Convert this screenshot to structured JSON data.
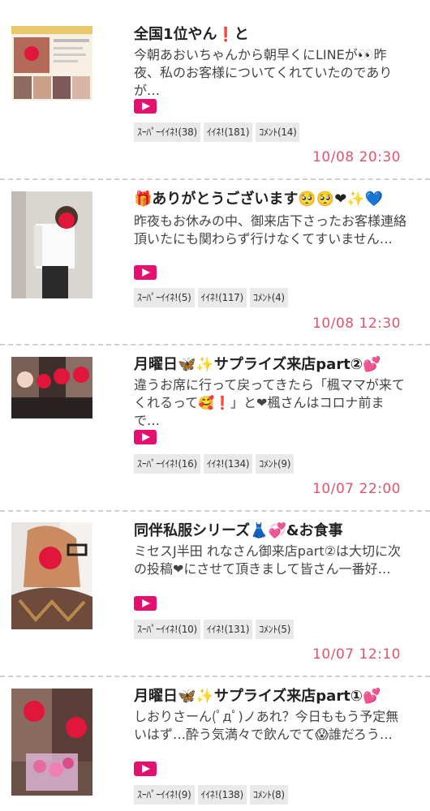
{
  "colors": {
    "accent": "#e3106e",
    "date": "#e0566f",
    "separator": "#cfcfcf"
  },
  "posts": [
    {
      "title": "全国1位やん",
      "title_icons": [
        "❗",
        "と"
      ],
      "excerpt": "今朝あおいちゃんから朝早くにLINEが👀昨夜、私のお客様についてくれていたのでありが…",
      "badges": [
        "ｽｰﾊﾟｰｲｲﾈ!(38)",
        "ｲｲﾈ!(181)",
        "ｺﾒﾝﾄ(14)"
      ],
      "date": "10/08 20:30",
      "thumb_icon": "ranking-screenshot-image"
    },
    {
      "title": "🎁ありがとうございます🥺🥺❤✨💙",
      "title_icons": [],
      "excerpt": "昨夜もお休みの中、御来店下さったお客様連絡頂いたにも関わらず行けなくてすいません…",
      "badges": [
        "ｽｰﾊﾟｰｲｲﾈ!(5)",
        "ｲｲﾈ!(117)",
        "ｺﾒﾝﾄ(4)"
      ],
      "date": "10/08 12:30",
      "thumb_icon": "woman-photo-image"
    },
    {
      "title": "月曜日🦋✨サプライズ来店part②💕",
      "title_icons": [],
      "excerpt": "違うお席に行って戻ってきたら「楓ママが来てくれるって🥰❗」と❤楓さんはコロナ前まで…",
      "badges": [
        "ｽｰﾊﾟｰｲｲﾈ!(16)",
        "ｲｲﾈ!(134)",
        "ｺﾒﾝﾄ(9)"
      ],
      "date": "10/07 22:00",
      "thumb_icon": "group-photo-image"
    },
    {
      "title": "同伴私服シリーズ👗💞&お食事",
      "title_icons": [],
      "excerpt": "ミセスJ半田 れなさん御来店part②は大切に次の投稿❤にさせて頂きまして皆さん一番好…",
      "badges": [
        "ｽｰﾊﾟｰｲｲﾈ!(10)",
        "ｲｲﾈ!(131)",
        "ｺﾒﾝﾄ(5)"
      ],
      "date": "10/07 12:10",
      "thumb_icon": "selfie-photo-image"
    },
    {
      "title": "月曜日🦋✨サプライズ来店part①💕",
      "title_icons": [],
      "excerpt": "しおりさーん(ﾟдﾟ)ノあれ？今日ももう予定無いはず…酔う気満々で飲んでて😱誰だろう…",
      "badges": [
        "ｽｰﾊﾟｰｲｲﾈ!(9)",
        "ｲｲﾈ!(138)",
        "ｺﾒﾝﾄ(8)"
      ],
      "date": "",
      "thumb_icon": "flowers-photo-image"
    }
  ]
}
